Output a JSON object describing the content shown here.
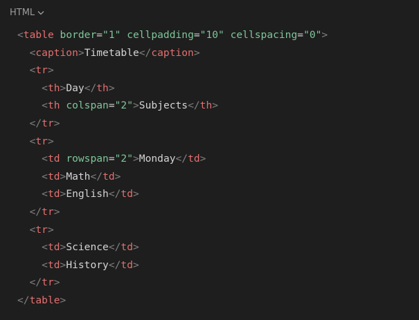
{
  "header": {
    "language_label": "HTML",
    "chevron_icon": "chevron-down-icon"
  },
  "code": {
    "lines": [
      [
        [
          "br",
          "<"
        ],
        [
          "tag",
          "table"
        ],
        [
          "sp",
          " "
        ],
        [
          "attr",
          "border"
        ],
        [
          "eq",
          "="
        ],
        [
          "val",
          "\"1\""
        ],
        [
          "sp",
          " "
        ],
        [
          "attr",
          "cellpadding"
        ],
        [
          "eq",
          "="
        ],
        [
          "val",
          "\"10\""
        ],
        [
          "sp",
          " "
        ],
        [
          "attr",
          "cellspacing"
        ],
        [
          "eq",
          "="
        ],
        [
          "val",
          "\"0\""
        ],
        [
          "br",
          ">"
        ]
      ],
      [
        [
          "sp",
          "  "
        ],
        [
          "br",
          "<"
        ],
        [
          "tag",
          "caption"
        ],
        [
          "br",
          ">"
        ],
        [
          "txt",
          "Timetable"
        ],
        [
          "br",
          "</"
        ],
        [
          "tag",
          "caption"
        ],
        [
          "br",
          ">"
        ]
      ],
      [
        [
          "sp",
          "  "
        ],
        [
          "br",
          "<"
        ],
        [
          "tag",
          "tr"
        ],
        [
          "br",
          ">"
        ]
      ],
      [
        [
          "sp",
          "    "
        ],
        [
          "br",
          "<"
        ],
        [
          "tag",
          "th"
        ],
        [
          "br",
          ">"
        ],
        [
          "txt",
          "Day"
        ],
        [
          "br",
          "</"
        ],
        [
          "tag",
          "th"
        ],
        [
          "br",
          ">"
        ]
      ],
      [
        [
          "sp",
          "    "
        ],
        [
          "br",
          "<"
        ],
        [
          "tag",
          "th"
        ],
        [
          "sp",
          " "
        ],
        [
          "attr",
          "colspan"
        ],
        [
          "eq",
          "="
        ],
        [
          "val",
          "\"2\""
        ],
        [
          "br",
          ">"
        ],
        [
          "txt",
          "Subjects"
        ],
        [
          "br",
          "</"
        ],
        [
          "tag",
          "th"
        ],
        [
          "br",
          ">"
        ]
      ],
      [
        [
          "sp",
          "  "
        ],
        [
          "br",
          "</"
        ],
        [
          "tag",
          "tr"
        ],
        [
          "br",
          ">"
        ]
      ],
      [
        [
          "sp",
          "  "
        ],
        [
          "br",
          "<"
        ],
        [
          "tag",
          "tr"
        ],
        [
          "br",
          ">"
        ]
      ],
      [
        [
          "sp",
          "    "
        ],
        [
          "br",
          "<"
        ],
        [
          "tag",
          "td"
        ],
        [
          "sp",
          " "
        ],
        [
          "attr",
          "rowspan"
        ],
        [
          "eq",
          "="
        ],
        [
          "val",
          "\"2\""
        ],
        [
          "br",
          ">"
        ],
        [
          "txt",
          "Monday"
        ],
        [
          "br",
          "</"
        ],
        [
          "tag",
          "td"
        ],
        [
          "br",
          ">"
        ]
      ],
      [
        [
          "sp",
          "    "
        ],
        [
          "br",
          "<"
        ],
        [
          "tag",
          "td"
        ],
        [
          "br",
          ">"
        ],
        [
          "txt",
          "Math"
        ],
        [
          "br",
          "</"
        ],
        [
          "tag",
          "td"
        ],
        [
          "br",
          ">"
        ]
      ],
      [
        [
          "sp",
          "    "
        ],
        [
          "br",
          "<"
        ],
        [
          "tag",
          "td"
        ],
        [
          "br",
          ">"
        ],
        [
          "txt",
          "English"
        ],
        [
          "br",
          "</"
        ],
        [
          "tag",
          "td"
        ],
        [
          "br",
          ">"
        ]
      ],
      [
        [
          "sp",
          "  "
        ],
        [
          "br",
          "</"
        ],
        [
          "tag",
          "tr"
        ],
        [
          "br",
          ">"
        ]
      ],
      [
        [
          "sp",
          "  "
        ],
        [
          "br",
          "<"
        ],
        [
          "tag",
          "tr"
        ],
        [
          "br",
          ">"
        ]
      ],
      [
        [
          "sp",
          "    "
        ],
        [
          "br",
          "<"
        ],
        [
          "tag",
          "td"
        ],
        [
          "br",
          ">"
        ],
        [
          "txt",
          "Science"
        ],
        [
          "br",
          "</"
        ],
        [
          "tag",
          "td"
        ],
        [
          "br",
          ">"
        ]
      ],
      [
        [
          "sp",
          "    "
        ],
        [
          "br",
          "<"
        ],
        [
          "tag",
          "td"
        ],
        [
          "br",
          ">"
        ],
        [
          "txt",
          "History"
        ],
        [
          "br",
          "</"
        ],
        [
          "tag",
          "td"
        ],
        [
          "br",
          ">"
        ]
      ],
      [
        [
          "sp",
          "  "
        ],
        [
          "br",
          "</"
        ],
        [
          "tag",
          "tr"
        ],
        [
          "br",
          ">"
        ]
      ],
      [
        [
          "br",
          "</"
        ],
        [
          "tag",
          "table"
        ],
        [
          "br",
          ">"
        ]
      ]
    ]
  },
  "colors": {
    "background": "#1e1e1e",
    "tag": "#e46f6f",
    "attribute": "#7ec699",
    "bracket": "#808080",
    "text": "#d4d4d4"
  }
}
